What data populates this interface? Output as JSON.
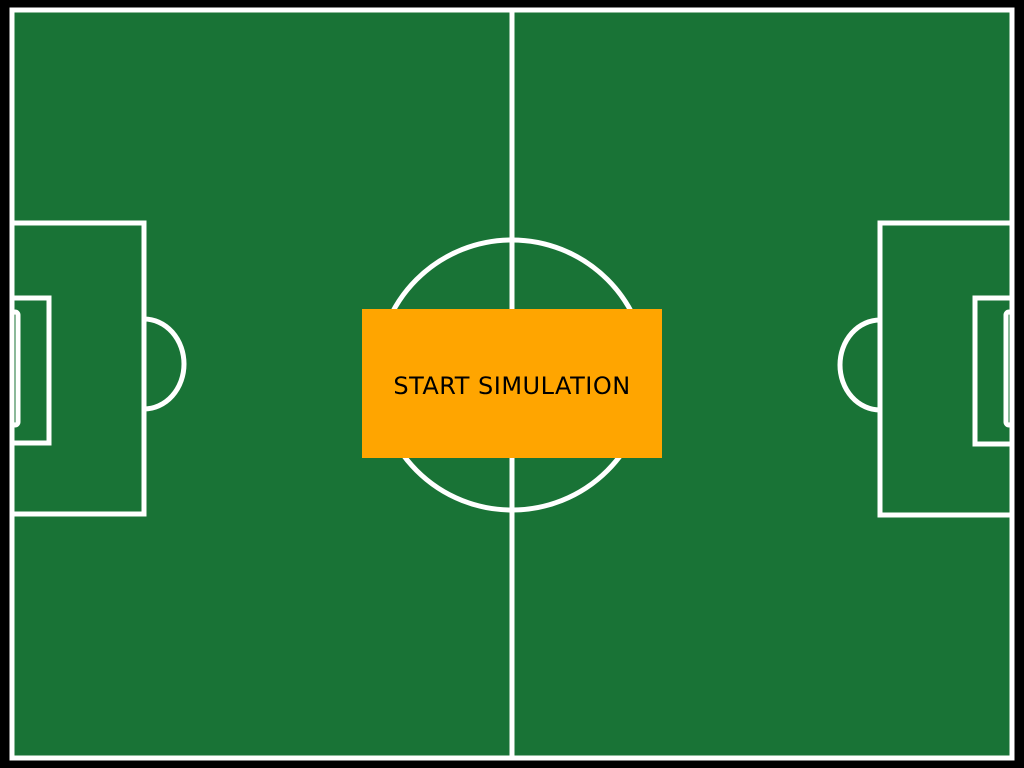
{
  "colors": {
    "background": "#000000",
    "pitch": "#197336",
    "lines": "#ffffff",
    "button": "#ffa500",
    "button_text": "#000000"
  },
  "start_button": {
    "label": "START SIMULATION"
  }
}
